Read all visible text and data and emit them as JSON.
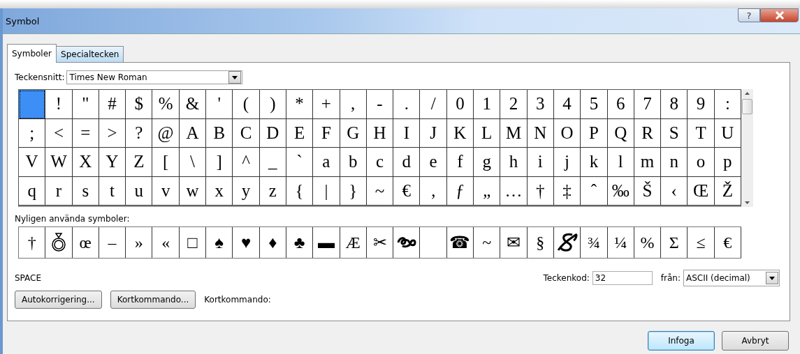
{
  "window": {
    "title": "Symbol",
    "help_button": "?"
  },
  "tabs": [
    {
      "label": "Symboler",
      "selected": true
    },
    {
      "label": "Specialtecken",
      "selected": false
    }
  ],
  "font": {
    "label": "Teckensnitt:",
    "value": "Times New Roman"
  },
  "grid": {
    "rows": [
      [
        {
          "selected": true
        },
        {
          "char": "!",
          "selected": false
        },
        {
          "char": "\"",
          "selected": false
        },
        {
          "char": "#",
          "selected": false
        },
        {
          "char": "$",
          "selected": false
        },
        {
          "char": "%",
          "selected": false
        },
        {
          "char": "&",
          "selected": false
        },
        {
          "char": "'",
          "selected": false
        },
        {
          "char": "(",
          "selected": false
        },
        {
          "char": ")",
          "selected": false
        },
        {
          "char": "*",
          "selected": false
        },
        {
          "char": "+",
          "selected": false
        },
        {
          "char": ",",
          "selected": false
        },
        {
          "char": "-",
          "selected": false
        },
        {
          "char": ".",
          "selected": false
        },
        {
          "char": "/",
          "selected": false
        },
        {
          "char": "0",
          "selected": false
        },
        {
          "char": "1",
          "selected": false
        },
        {
          "char": "2",
          "selected": false
        },
        {
          "char": "3",
          "selected": false
        },
        {
          "char": "4",
          "selected": false
        },
        {
          "char": "5",
          "selected": false
        },
        {
          "char": "6",
          "selected": false
        },
        {
          "char": "7",
          "selected": false
        },
        {
          "char": "8",
          "selected": false
        },
        {
          "char": "9",
          "selected": false
        },
        {
          "char": ":",
          "selected": false
        }
      ],
      [
        {
          "char": ";",
          "selected": false
        },
        {
          "char": "<",
          "selected": false
        },
        {
          "char": "=",
          "selected": false
        },
        {
          "char": ">",
          "selected": false
        },
        {
          "char": "?",
          "selected": false
        },
        {
          "char": "@",
          "selected": false
        },
        {
          "char": "A",
          "selected": false
        },
        {
          "char": "B",
          "selected": false
        },
        {
          "char": "C",
          "selected": false
        },
        {
          "char": "D",
          "selected": false
        },
        {
          "char": "E",
          "selected": false
        },
        {
          "char": "F",
          "selected": false
        },
        {
          "char": "G",
          "selected": false
        },
        {
          "char": "H",
          "selected": false
        },
        {
          "char": "I",
          "selected": false
        },
        {
          "char": "J",
          "selected": false
        },
        {
          "char": "K",
          "selected": false
        },
        {
          "char": "L",
          "selected": false
        },
        {
          "char": "M",
          "selected": false
        },
        {
          "char": "N",
          "selected": false
        },
        {
          "char": "O",
          "selected": false
        },
        {
          "char": "P",
          "selected": false
        },
        {
          "char": "Q",
          "selected": false
        },
        {
          "char": "R",
          "selected": false
        },
        {
          "char": "S",
          "selected": false
        },
        {
          "char": "T",
          "selected": false
        },
        {
          "char": "U",
          "selected": false
        }
      ],
      [
        {
          "char": "V",
          "selected": false
        },
        {
          "char": "W",
          "selected": false
        },
        {
          "char": "X",
          "selected": false
        },
        {
          "char": "Y",
          "selected": false
        },
        {
          "char": "Z",
          "selected": false
        },
        {
          "char": "[",
          "selected": false
        },
        {
          "char": "\\",
          "selected": false
        },
        {
          "char": "]",
          "selected": false
        },
        {
          "char": "^",
          "selected": false
        },
        {
          "char": "_",
          "selected": false
        },
        {
          "char": "`",
          "selected": false
        },
        {
          "char": "a",
          "selected": false
        },
        {
          "char": "b",
          "selected": false
        },
        {
          "char": "c",
          "selected": false
        },
        {
          "char": "d",
          "selected": false
        },
        {
          "char": "e",
          "selected": false
        },
        {
          "char": "f",
          "selected": false
        },
        {
          "char": "g",
          "selected": false
        },
        {
          "char": "h",
          "selected": false
        },
        {
          "char": "i",
          "selected": false
        },
        {
          "char": "j",
          "selected": false
        },
        {
          "char": "k",
          "selected": false
        },
        {
          "char": "l",
          "selected": false
        },
        {
          "char": "m",
          "selected": false
        },
        {
          "char": "n",
          "selected": false
        },
        {
          "char": "o",
          "selected": false
        },
        {
          "char": "p",
          "selected": false
        }
      ],
      [
        {
          "char": "q",
          "selected": false
        },
        {
          "char": "r",
          "selected": false
        },
        {
          "char": "s",
          "selected": false
        },
        {
          "char": "t",
          "selected": false
        },
        {
          "char": "u",
          "selected": false
        },
        {
          "char": "v",
          "selected": false
        },
        {
          "char": "w",
          "selected": false
        },
        {
          "char": "x",
          "selected": false
        },
        {
          "char": "y",
          "selected": false
        },
        {
          "char": "z",
          "selected": false
        },
        {
          "char": "{",
          "selected": false
        },
        {
          "char": "|",
          "selected": false
        },
        {
          "char": "}",
          "selected": false
        },
        {
          "char": "~",
          "selected": false
        },
        {
          "char": "€",
          "selected": false
        },
        {
          "char": "‚",
          "selected": false
        },
        {
          "char": "ƒ",
          "selected": false
        },
        {
          "char": "„",
          "selected": false
        },
        {
          "char": "…",
          "selected": false
        },
        {
          "char": "†",
          "selected": false
        },
        {
          "char": "‡",
          "selected": false
        },
        {
          "char": "ˆ",
          "selected": false
        },
        {
          "char": "‰",
          "selected": false
        },
        {
          "char": "Š",
          "selected": false
        },
        {
          "char": "‹",
          "selected": false
        },
        {
          "char": "Œ",
          "selected": false
        },
        {
          "char": "Ž",
          "selected": false
        }
      ]
    ]
  },
  "recent": {
    "label": "Nyligen använda symboler:",
    "items": [
      {
        "kind": "char",
        "char": "†"
      },
      {
        "kind": "ring"
      },
      {
        "kind": "char",
        "char": "œ"
      },
      {
        "kind": "char",
        "char": "–"
      },
      {
        "kind": "char",
        "char": "»"
      },
      {
        "kind": "char",
        "char": "«"
      },
      {
        "kind": "char",
        "char": "□"
      },
      {
        "kind": "char",
        "char": "♠"
      },
      {
        "kind": "char",
        "char": "♥"
      },
      {
        "kind": "char",
        "char": "♦"
      },
      {
        "kind": "char",
        "char": "♣"
      },
      {
        "kind": "char",
        "char": "▬"
      },
      {
        "kind": "char",
        "char": "Æ"
      },
      {
        "kind": "char",
        "char": "✂"
      },
      {
        "kind": "swirl"
      },
      {
        "kind": "blank"
      },
      {
        "kind": "char",
        "char": "☎"
      },
      {
        "kind": "char",
        "char": "~"
      },
      {
        "kind": "char",
        "char": "✉"
      },
      {
        "kind": "char",
        "char": "§"
      },
      {
        "kind": "signature"
      },
      {
        "kind": "char",
        "char": "¾"
      },
      {
        "kind": "char",
        "char": "¼"
      },
      {
        "kind": "char",
        "char": "%"
      },
      {
        "kind": "char",
        "char": "Σ"
      },
      {
        "kind": "char",
        "char": "≤"
      },
      {
        "kind": "char",
        "char": "€"
      }
    ]
  },
  "char_name": "SPACE",
  "char_code": {
    "label": "Teckenkod:",
    "value": "32"
  },
  "from": {
    "label": "från:",
    "value": "ASCII (decimal)"
  },
  "buttons": [
    {
      "label": "Autokorrigering..."
    },
    {
      "label": "Kortkommando..."
    }
  ],
  "shortcut_label": "Kortkommando:",
  "dialog_buttons": [
    {
      "label": "Infoga",
      "default": true
    },
    {
      "label": "Avbryt",
      "default": false
    }
  ]
}
